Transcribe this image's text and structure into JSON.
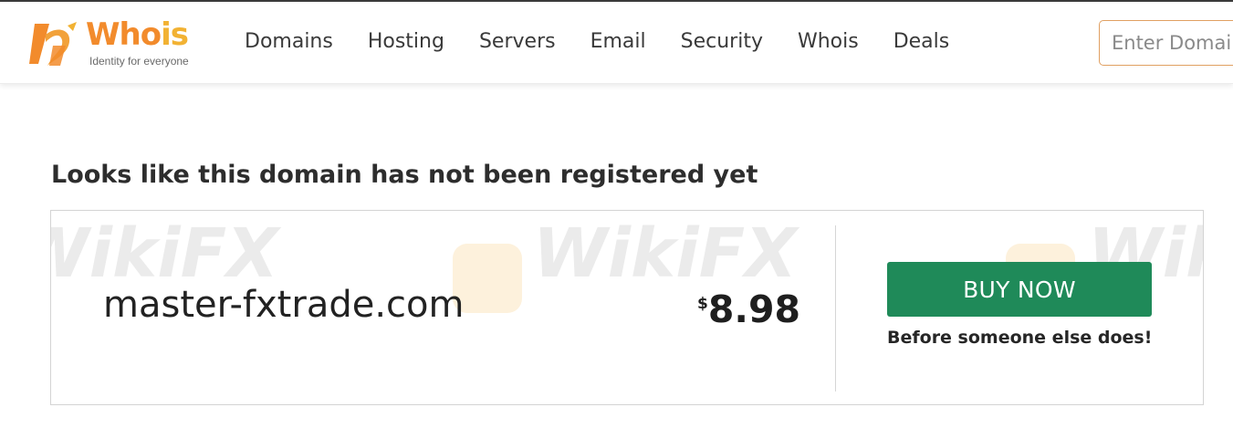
{
  "header": {
    "logo": {
      "word_part1": "Who",
      "word_part2": "is",
      "tagline": "Identity for everyone",
      "colors": {
        "primary": "#f28b2c",
        "secondary": "#f2b233"
      }
    },
    "nav": [
      "Domains",
      "Hosting",
      "Servers",
      "Email",
      "Security",
      "Whois",
      "Deals"
    ],
    "search": {
      "placeholder": "Enter Domain",
      "value": ""
    }
  },
  "main": {
    "headline": "Looks like this domain has not been registered yet",
    "result": {
      "domain": "master-fxtrade.com",
      "currency_symbol": "$",
      "price": "8.98",
      "buy_label": "BUY NOW",
      "buy_note": "Before someone else does!",
      "button_color": "#1f8a59"
    }
  },
  "watermark": {
    "text": "WikiFX"
  }
}
